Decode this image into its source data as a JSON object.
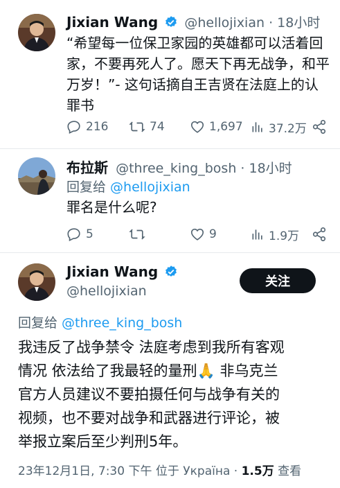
{
  "tweet1": {
    "name": "Jixian Wang",
    "handle_time": "@hellojixian · 18小时",
    "text_lines": [
      "“希望每一位保卫家园的英雄都可以活着回",
      "家，不要再死人了。愿天下再无战争，和平",
      "万岁！”- 这句话摘自王吉贤在法庭上的认",
      "罪书"
    ],
    "replies": "216",
    "retweets": "74",
    "likes": "1,697",
    "views": "37.2万"
  },
  "tweet2": {
    "name": "布拉斯",
    "handle_time": "@three_king_bosh · 18小时",
    "reply_prefix": "回复给 ",
    "reply_to": "@hellojixian",
    "text": "罪名是什么呢?",
    "replies": "5",
    "likes": "9",
    "views": "1.9万"
  },
  "tweet3": {
    "name": "Jixian Wang",
    "handle": "@hellojixian",
    "follow_label": "关注",
    "reply_prefix": "回复给 ",
    "reply_to": "@three_king_bosh",
    "text_lines": [
      "我违反了战争禁令 法庭考虑到我所有客观",
      "情况 依法给了我最轻的量刑🙏 非乌克兰",
      "官方人员建议不要拍摄任何与战争有关的",
      "视频，也不要对战争和武器进行评论，被",
      "举报立案后至少判刑5年。"
    ],
    "meta_prefix": "23年12月1日, 7:30 下午 位于 Україна · ",
    "views_count": "1.5万",
    "views_label": " 查看"
  },
  "colors": {
    "text": "#0f1419",
    "secondary": "#536471",
    "link": "#1d9bf0",
    "verified": "#1d9bf0",
    "divider": "#e6e9ec"
  },
  "icons": [
    "reply-icon",
    "retweet-icon",
    "like-icon",
    "views-icon",
    "share-icon",
    "verified-badge-icon"
  ]
}
